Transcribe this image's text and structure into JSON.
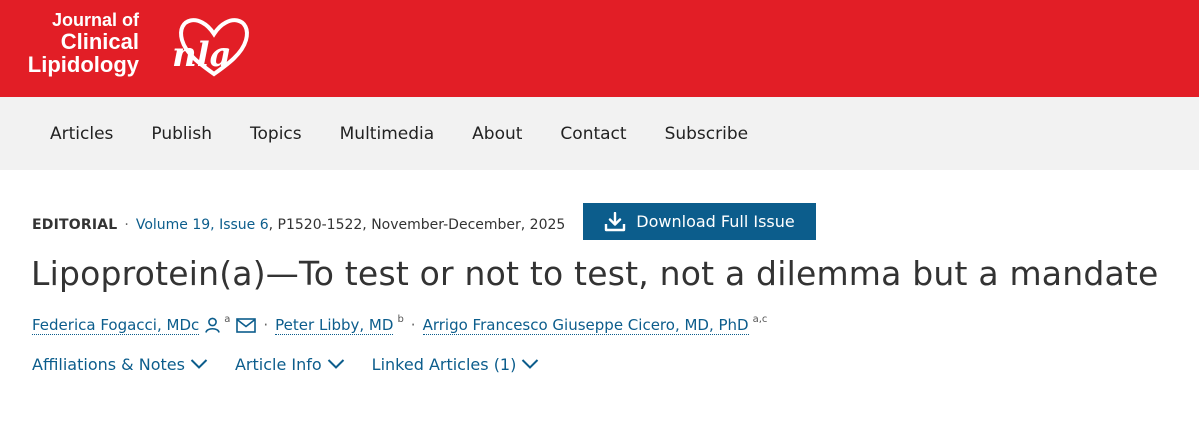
{
  "brand": {
    "journal_line1": "Journal of",
    "journal_line2": "Clinical",
    "journal_line3": "Lipidology",
    "logo_text": "nla",
    "color_primary": "#e21e26"
  },
  "nav": {
    "items": [
      {
        "label": "Articles"
      },
      {
        "label": "Publish"
      },
      {
        "label": "Topics"
      },
      {
        "label": "Multimedia"
      },
      {
        "label": "About"
      },
      {
        "label": "Contact"
      },
      {
        "label": "Subscribe"
      }
    ]
  },
  "article": {
    "type": "EDITORIAL",
    "separator": "·",
    "volume_issue": "Volume 19, Issue 6",
    "pages_date": ", P1520-1522, November-December, 2025",
    "download_label": "Download Full Issue",
    "download_icon": "download-icon",
    "title": "Lipoprotein(a)—To test or not to test, not a dilemma but a mandate",
    "accent_color": "#0c5d8c"
  },
  "authors": [
    {
      "name": "Federica Fogacci, MDc",
      "sup": "a",
      "icons": [
        "person-icon",
        "envelope-icon"
      ]
    },
    {
      "name": "Peter Libby, MD",
      "sup": "b"
    },
    {
      "name": "Arrigo Francesco Giuseppe Cicero, MD, PhD",
      "sup": "a,c"
    }
  ],
  "toggles": [
    {
      "label": "Affiliations & Notes",
      "icon": "chevron-down-icon"
    },
    {
      "label": "Article Info",
      "icon": "chevron-down-icon"
    },
    {
      "label": "Linked Articles (1)",
      "icon": "chevron-down-icon"
    }
  ]
}
